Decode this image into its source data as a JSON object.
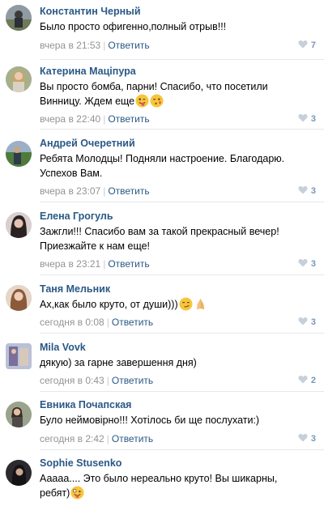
{
  "comments": [
    {
      "author": "Константин Черный",
      "text_lines": [
        "Было просто офигенно,полный отрыв!!!"
      ],
      "time": "вчера в 21:53",
      "reply": "Ответить",
      "likes": "7",
      "avatar_color": "#7e8a76"
    },
    {
      "author": "Катерина Маціпура",
      "text_lines": [
        "Вы просто бомба, парни! Спасибо, что посетили",
        "Винницу. Ждем еще"
      ],
      "time": "вчера в 22:40",
      "reply": "Ответить",
      "likes": "3",
      "avatar_color": "#b7a37a"
    },
    {
      "author": "Андрей Очеретний",
      "text_lines": [
        "Ребята Молодцы! Подняли настроение. Благодарю.",
        "Успехов Вам."
      ],
      "time": "вчера в 23:07",
      "reply": "Ответить",
      "likes": "3",
      "avatar_color": "#5f7d4f"
    },
    {
      "author": "Елена Грогуль",
      "text_lines": [
        "Зажгли!!! Спасибо вам за такой прекрасный вечер!",
        "Приезжайте к нам еще!"
      ],
      "time": "вчера в 23:21",
      "reply": "Ответить",
      "likes": "3",
      "avatar_color": "#5a4a4a"
    },
    {
      "author": "Таня Мельник",
      "text_lines": [
        "Ах,как было круто, от души)))"
      ],
      "time": "сегодня в 0:08",
      "reply": "Ответить",
      "likes": "3",
      "avatar_color": "#c8a08a"
    },
    {
      "author": "Mila Vovk",
      "text_lines": [
        "дякую) за гарне завершення дня)"
      ],
      "time": "сегодня в 0:43",
      "reply": "Ответить",
      "likes": "2",
      "avatar_color": "#8f8fb0"
    },
    {
      "author": "Евника Почапская",
      "text_lines": [
        "Було неймовірно!!! Хотілось би ще послухати:)"
      ],
      "time": "сегодня в 2:42",
      "reply": "Ответить",
      "likes": "3",
      "avatar_color": "#6a5a50"
    },
    {
      "author": "Sophie Stusenko",
      "text_lines": [
        "Ааааа.... Это было нереально круто! Вы шикарны,",
        "ребят)"
      ],
      "time": "",
      "reply": "",
      "likes": "",
      "avatar_color": "#3d3b3f"
    }
  ],
  "colors": {
    "author_link": "#2a5885",
    "meta_gray": "#939393",
    "like_blue": "#7996b6",
    "divider": "#e7e8ec"
  },
  "icons": {
    "like": "heart-icon",
    "emoji_wink_tongue": "winking-face-with-tongue-emoji",
    "emoji_kiss": "face-blowing-kiss-emoji",
    "emoji_smirk": "smirking-face-emoji",
    "emoji_pray": "folded-hands-emoji",
    "emoji_zany": "zany-face-emoji"
  }
}
